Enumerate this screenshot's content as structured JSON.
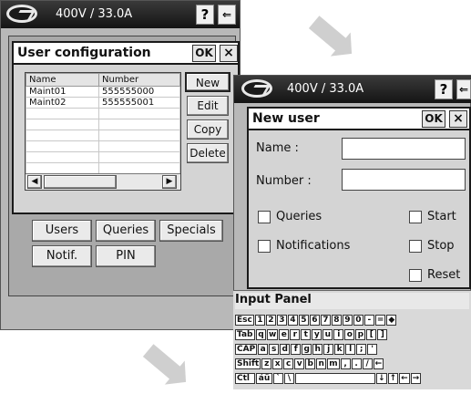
{
  "screen1": {
    "status": "400V / 33.0A",
    "dialog": {
      "title": "User configuration",
      "ok": "OK",
      "close": "×",
      "table": {
        "headers": [
          "Name",
          "Number"
        ],
        "rows": [
          [
            "Maint01",
            "555555000"
          ],
          [
            "Maint02",
            "555555001"
          ]
        ]
      },
      "buttons": {
        "new": "New",
        "edit": "Edit",
        "copy": "Copy",
        "delete": "Delete"
      },
      "scroll_left": "◀",
      "scroll_right": "▶"
    },
    "tabs": {
      "users": "Users",
      "queries": "Queries",
      "specials": "Specials",
      "notif": "Notif.",
      "pin": "PIN"
    }
  },
  "screen2": {
    "status": "400V / 33.0A",
    "dialog": {
      "title": "New user",
      "ok": "OK",
      "close": "×",
      "name_label": "Name :",
      "name_value": "",
      "number_label": "Number :",
      "number_value": "",
      "queries": "Queries",
      "notifications": "Notifications",
      "start": "Start",
      "stop": "Stop",
      "reset": "Reset"
    },
    "input_panel": {
      "title": "Input Panel",
      "rows": [
        [
          "Esc",
          "1",
          "2",
          "3",
          "4",
          "5",
          "6",
          "7",
          "8",
          "9",
          "0",
          "-",
          "=",
          "◆"
        ],
        [
          "Tab",
          "q",
          "w",
          "e",
          "r",
          "t",
          "y",
          "u",
          "i",
          "o",
          "p",
          "[",
          "]"
        ],
        [
          "CAP",
          "a",
          "s",
          "d",
          "f",
          "g",
          "h",
          "j",
          "k",
          "l",
          ";",
          "'"
        ],
        [
          "Shift",
          "z",
          "x",
          "c",
          "v",
          "b",
          "n",
          "m",
          ",",
          ".",
          "/",
          "←"
        ],
        [
          "Ctl",
          "áü",
          "`",
          "\\",
          "↓",
          "↑",
          "←",
          "→"
        ]
      ]
    }
  },
  "help_icon": "?",
  "colors": {
    "titlebar": "#141414",
    "panel": "#a9a9a9",
    "dialog": "#d4d4d4",
    "arrow": "#cfcfcf"
  }
}
